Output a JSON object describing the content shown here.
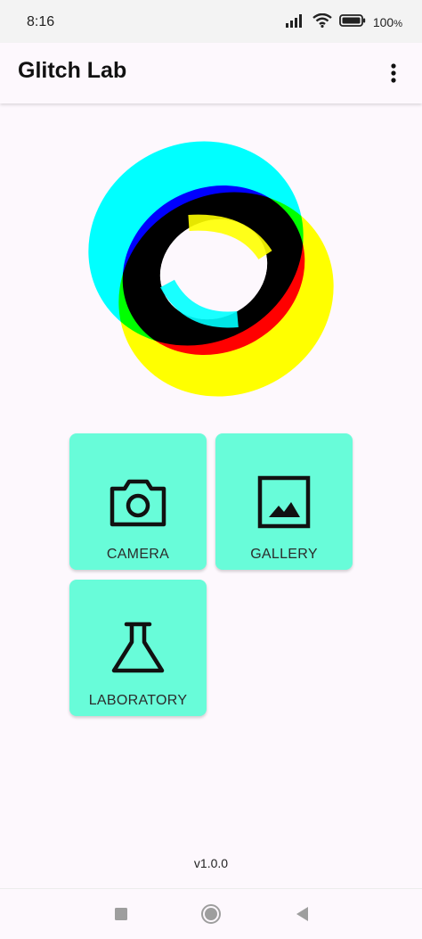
{
  "status_bar": {
    "time": "8:16",
    "battery": "100",
    "battery_unit": "%",
    "icons": [
      "signal-icon",
      "wifi-icon",
      "battery-icon"
    ]
  },
  "app_bar": {
    "title": "Glitch Lab",
    "menu_icon": "overflow-menu-icon"
  },
  "tiles": [
    {
      "label": "CAMERA",
      "icon": "camera-icon"
    },
    {
      "label": "GALLERY",
      "icon": "image-icon"
    },
    {
      "label": "LABORATORY",
      "icon": "flask-icon"
    }
  ],
  "version": "v1.0.0",
  "nav_bar": {
    "buttons": [
      "recents-button",
      "home-button",
      "back-button"
    ]
  },
  "colors": {
    "background": "#fdf8fd",
    "tile": "#68fcd9",
    "logo": [
      "#00ffff",
      "#ffff00",
      "#ff00ff",
      "#0000ff",
      "#ff0000",
      "#000000"
    ]
  }
}
